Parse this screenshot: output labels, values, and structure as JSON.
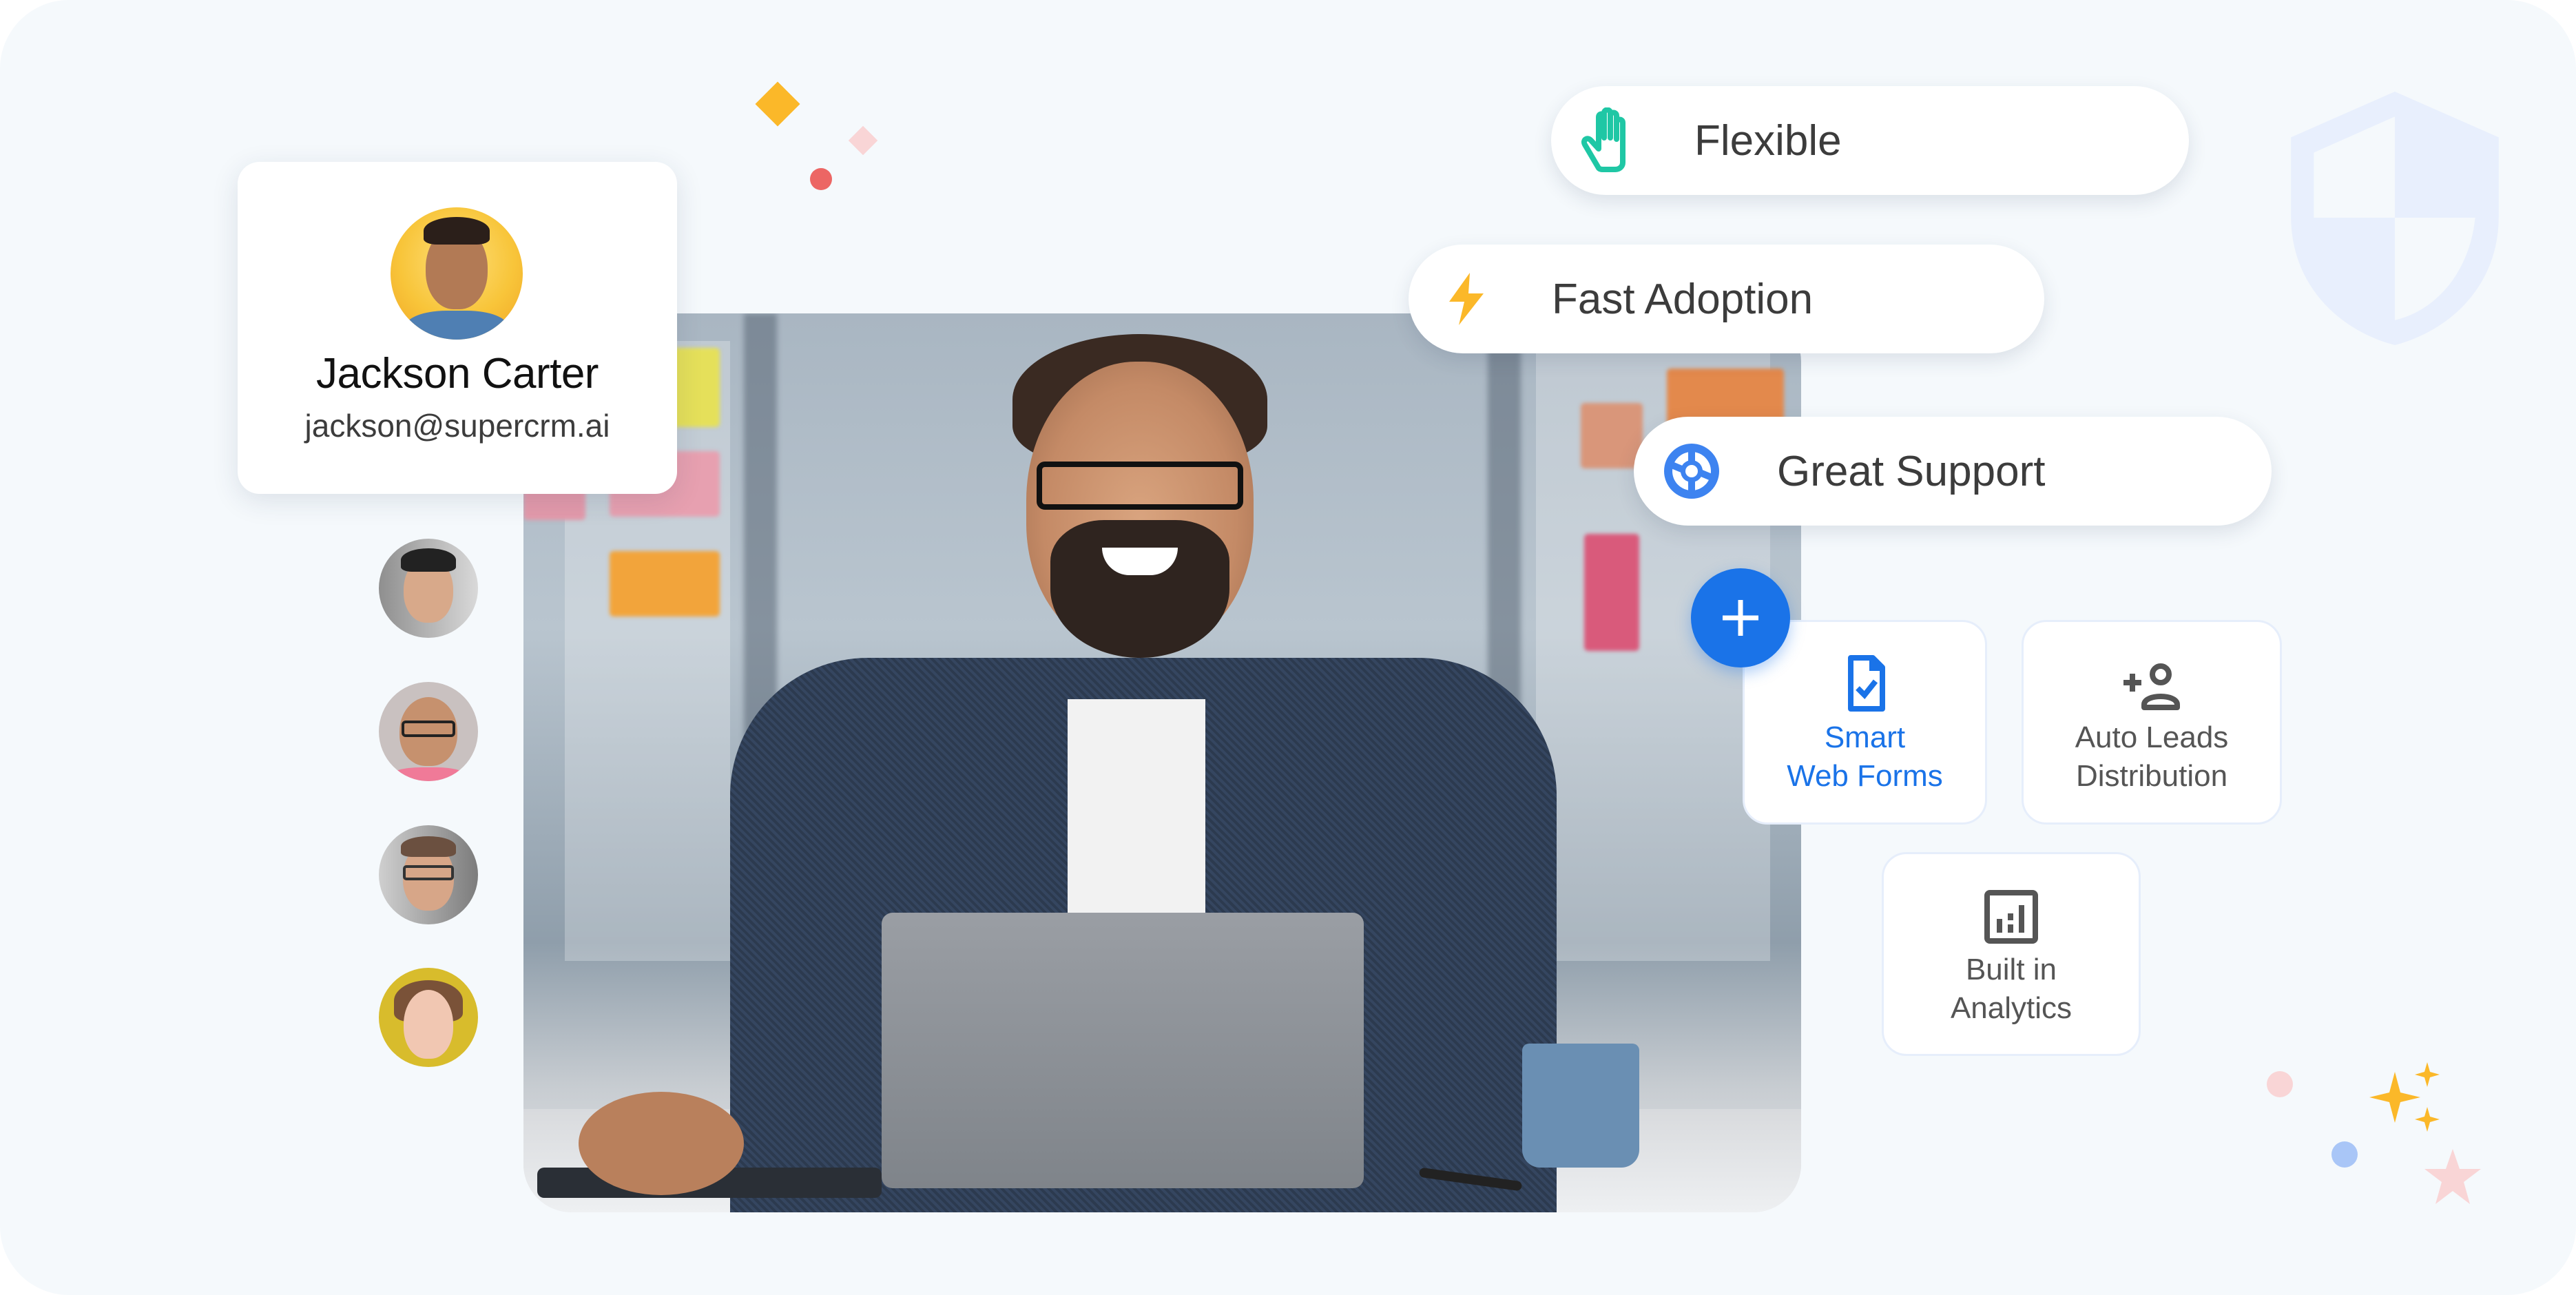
{
  "profile": {
    "name": "Jackson Carter",
    "email": "jackson@supercrm.ai"
  },
  "team_avatars": [
    {
      "label": "team-member-1"
    },
    {
      "label": "team-member-2"
    },
    {
      "label": "team-member-3"
    },
    {
      "label": "team-member-4"
    }
  ],
  "benefits": [
    {
      "label": "Flexible",
      "icon": "hand-icon",
      "color": "#1fc7a5"
    },
    {
      "label": "Fast Adoption",
      "icon": "lightning-icon",
      "color": "#fbb829"
    },
    {
      "label": "Great Support",
      "icon": "lifebuoy-icon",
      "color": "#3d83f0"
    }
  ],
  "add_button": {
    "icon": "plus-icon",
    "color": "#1a73e8"
  },
  "features": [
    {
      "line1": "Smart",
      "line2": "Web Forms",
      "icon": "form-check-icon",
      "color": "#1a73e8",
      "active": true
    },
    {
      "line1": "Auto Leads",
      "line2": "Distribution",
      "icon": "person-add-icon",
      "color": "#555555",
      "active": false
    },
    {
      "line1": "Built in",
      "line2": "Analytics",
      "icon": "analytics-icon",
      "color": "#555555",
      "active": false
    }
  ],
  "colors": {
    "background": "#f5f9fc",
    "accent_blue": "#1a73e8",
    "teal": "#1fc7a5",
    "amber": "#fbb829",
    "coral": "#ec6664",
    "blush": "#f9d5d6",
    "soft_blue": "#a9c6f7",
    "shield": "#e8effd"
  }
}
